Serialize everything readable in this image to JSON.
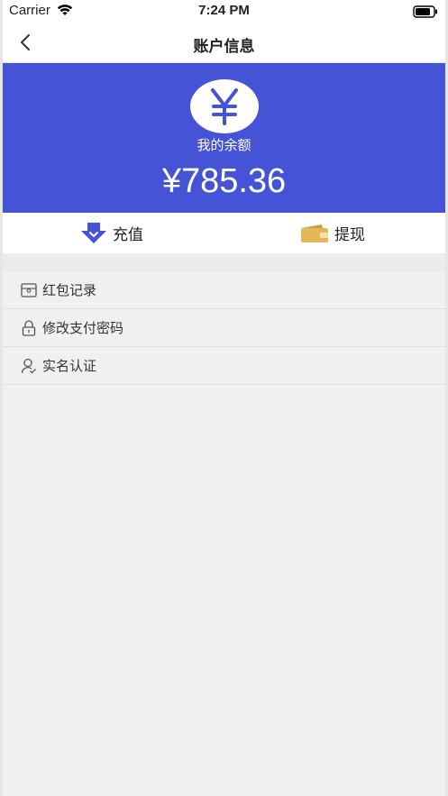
{
  "status_bar": {
    "carrier": "Carrier",
    "time": "7:24 PM"
  },
  "nav": {
    "title": "账户信息"
  },
  "balance": {
    "label": "我的余额",
    "amount": "¥785.36"
  },
  "actions": [
    {
      "label": "充值",
      "icon": "download-arrow-icon"
    },
    {
      "label": "提现",
      "icon": "wallet-icon"
    }
  ],
  "menu": [
    {
      "label": "红包记录",
      "icon": "red-packet-icon"
    },
    {
      "label": "修改支付密码",
      "icon": "lock-icon"
    },
    {
      "label": "实名认证",
      "icon": "user-verify-icon"
    }
  ],
  "colors": {
    "primary": "#4553d6",
    "wallet": "#e2b95a",
    "recharge": "#4553d6"
  }
}
